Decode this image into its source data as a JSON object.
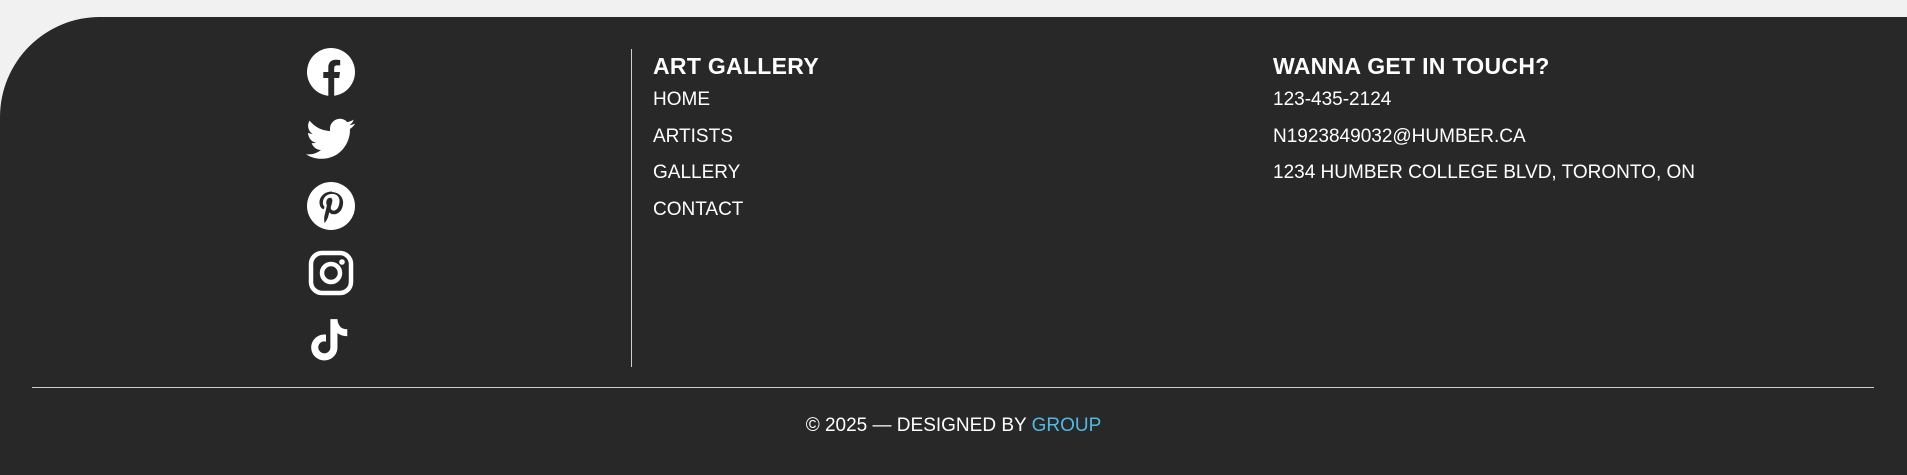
{
  "colors": {
    "page_bg": "#f1f1f1",
    "footer_bg": "#282828",
    "text": "#ffffff",
    "accent_link": "#4fb9e3",
    "divider": "#cfcfcf"
  },
  "social": {
    "icons": [
      {
        "name": "facebook-icon"
      },
      {
        "name": "twitter-icon"
      },
      {
        "name": "pinterest-icon"
      },
      {
        "name": "instagram-icon"
      },
      {
        "name": "tiktok-icon"
      }
    ]
  },
  "nav": {
    "heading": "ART GALLERY",
    "items": [
      {
        "label": "HOME"
      },
      {
        "label": "ARTISTS"
      },
      {
        "label": "GALLERY"
      },
      {
        "label": "CONTACT"
      }
    ]
  },
  "contact": {
    "heading": "WANNA GET IN TOUCH?",
    "phone": "123-435-2124",
    "email": "N1923849032@HUMBER.CA",
    "address": "1234 HUMBER COLLEGE BLVD, TORONTO, ON"
  },
  "copyright": {
    "prefix": "© 2025 — DESIGNED BY ",
    "link_label": "GROUP"
  }
}
